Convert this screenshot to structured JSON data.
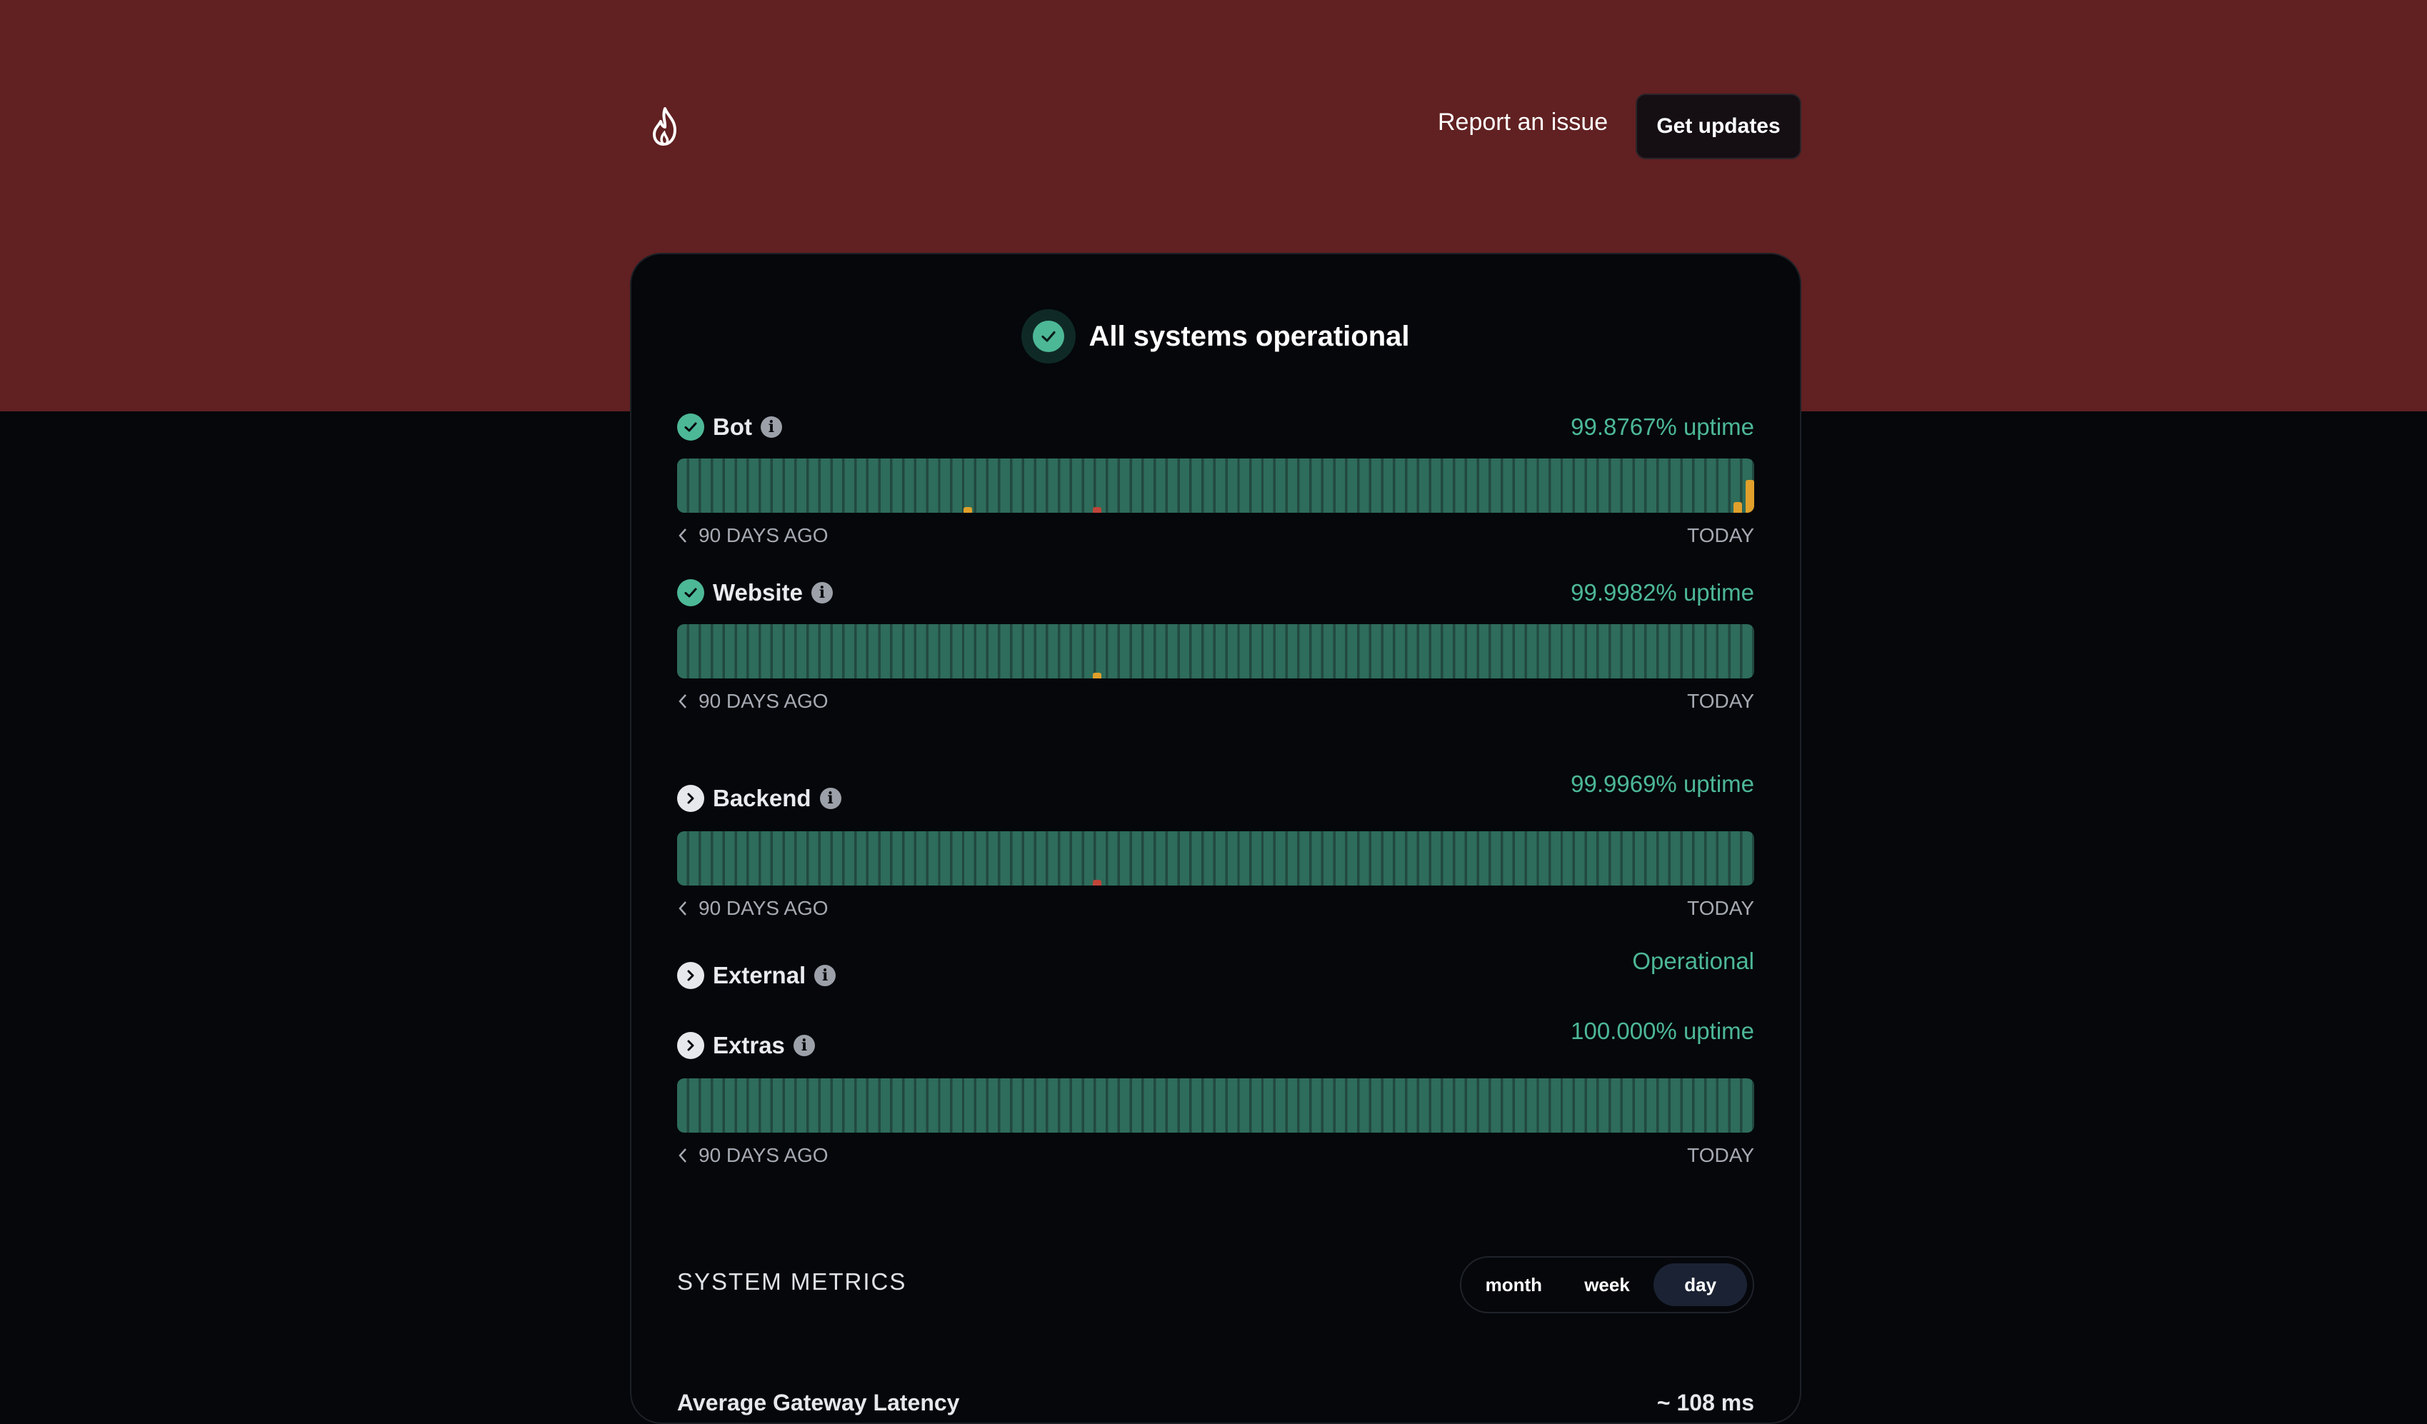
{
  "header": {
    "logo_icon": "flame-icon",
    "report_label": "Report an issue",
    "updates_label": "Get updates"
  },
  "status": {
    "overall_text": "All systems operational",
    "accent_color": "#4db896",
    "brand_color": "#612021"
  },
  "components": [
    {
      "name": "Bot",
      "uptime": "99.8767% uptime",
      "status_icon": "check-circle-icon",
      "incidents": [
        {
          "day_fraction": 0.27,
          "level": 0.1,
          "color": "#e0a02b"
        },
        {
          "day_fraction": 0.39,
          "level": 0.1,
          "color": "#c0453a"
        },
        {
          "day_fraction": 0.985,
          "level": 0.2,
          "color": "#e0a02b"
        },
        {
          "day_fraction": 0.997,
          "level": 0.6,
          "color": "#e0a02b"
        }
      ]
    },
    {
      "name": "Website",
      "uptime": "99.9982% uptime",
      "status_icon": "check-circle-icon",
      "incidents": [
        {
          "day_fraction": 0.39,
          "level": 0.1,
          "color": "#e0a02b"
        }
      ]
    },
    {
      "name": "Backend",
      "uptime": "99.9969% uptime",
      "status_icon": "chevron-right-icon",
      "incidents": [
        {
          "day_fraction": 0.39,
          "level": 0.1,
          "color": "#c0453a"
        }
      ]
    },
    {
      "name": "External",
      "uptime": "Operational",
      "status_icon": "chevron-right-icon",
      "incidents": []
    },
    {
      "name": "Extras",
      "uptime": "100.000% uptime",
      "status_icon": "chevron-right-icon",
      "incidents": []
    }
  ],
  "bar_labels": {
    "start": "90 DAYS AGO",
    "end": "TODAY"
  },
  "metrics": {
    "title": "SYSTEM METRICS",
    "tabs": [
      "month",
      "week",
      "day"
    ],
    "active_tab": "day",
    "latency_label": "Average Gateway Latency",
    "latency_value": "~ 108 ms"
  }
}
